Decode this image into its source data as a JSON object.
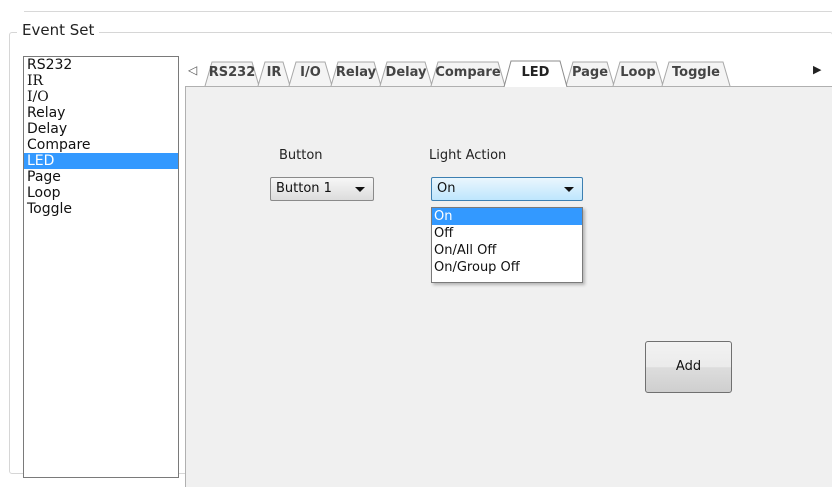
{
  "group": {
    "title": "Event Set"
  },
  "event_list": {
    "items": [
      "RS232",
      "IR",
      "I/O",
      "Relay",
      "Delay",
      "Compare",
      "LED",
      "Page",
      "Loop",
      "Toggle"
    ],
    "selected": "LED"
  },
  "tabs": {
    "items": [
      "RS232",
      "IR",
      "I/O",
      "Relay",
      "Delay",
      "Compare",
      "LED",
      "Page",
      "Loop",
      "Toggle"
    ],
    "active": "LED",
    "scroll_left_icon": "triangle-left-icon",
    "scroll_right_icon": "triangle-right-icon"
  },
  "led_panel": {
    "button_label": "Button",
    "button_value": "Button 1",
    "light_action_label": "Light Action",
    "light_action_value": "On",
    "light_action_options": [
      "On",
      "Off",
      "On/All Off",
      "On/Group Off"
    ],
    "highlighted_option": "On",
    "add_label": "Add"
  },
  "colors": {
    "selection": "#3399ff",
    "panel_bg": "#f0f0f0",
    "open_combo": "#bee6fd"
  }
}
